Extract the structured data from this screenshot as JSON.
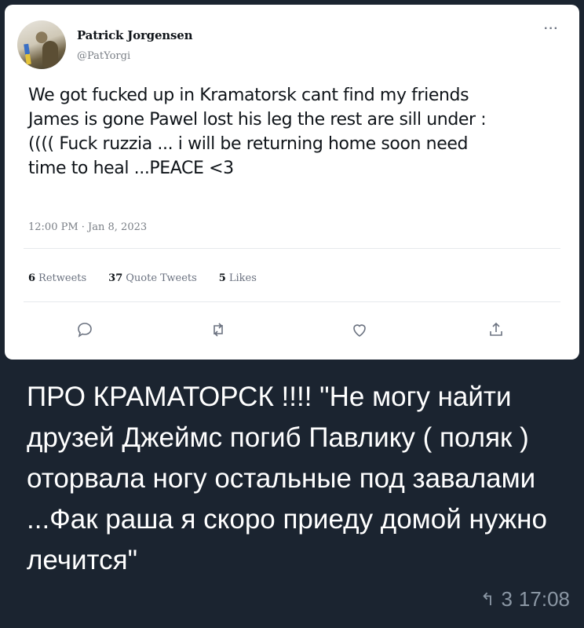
{
  "tweet": {
    "author_name": "Patrick Jorgensen",
    "author_handle": "@PatYorgi",
    "text": "We got fucked up in Kramatorsk cant find my friends\nJames is gone Pawel lost his leg the rest are sill under :\n(((( Fuck ruzzia ... i will be returning home soon need\ntime to heal ...PEACE <3",
    "timestamp": "12:00 PM · Jan 8, 2023",
    "retweets_count": "6",
    "retweets_label": "Retweets",
    "quote_count": "37",
    "quote_label": "Quote Tweets",
    "likes_count": "5",
    "likes_label": "Likes",
    "more_icon": "···"
  },
  "message": {
    "caption": "ПРО КРАМАТОРСК !!!! \"Не могу найти друзей Джеймс погиб Павлику ( поляк ) оторвала ногу остальные под завалами ...Фак раша я скоро приеду домой нужно лечится\"",
    "reply_icon": "↰",
    "reply_count": "3",
    "time": "17:08"
  },
  "colors": {
    "background": "#1b2430",
    "card": "#ffffff",
    "text": "#0f1419",
    "muted": "#7a7f86"
  }
}
